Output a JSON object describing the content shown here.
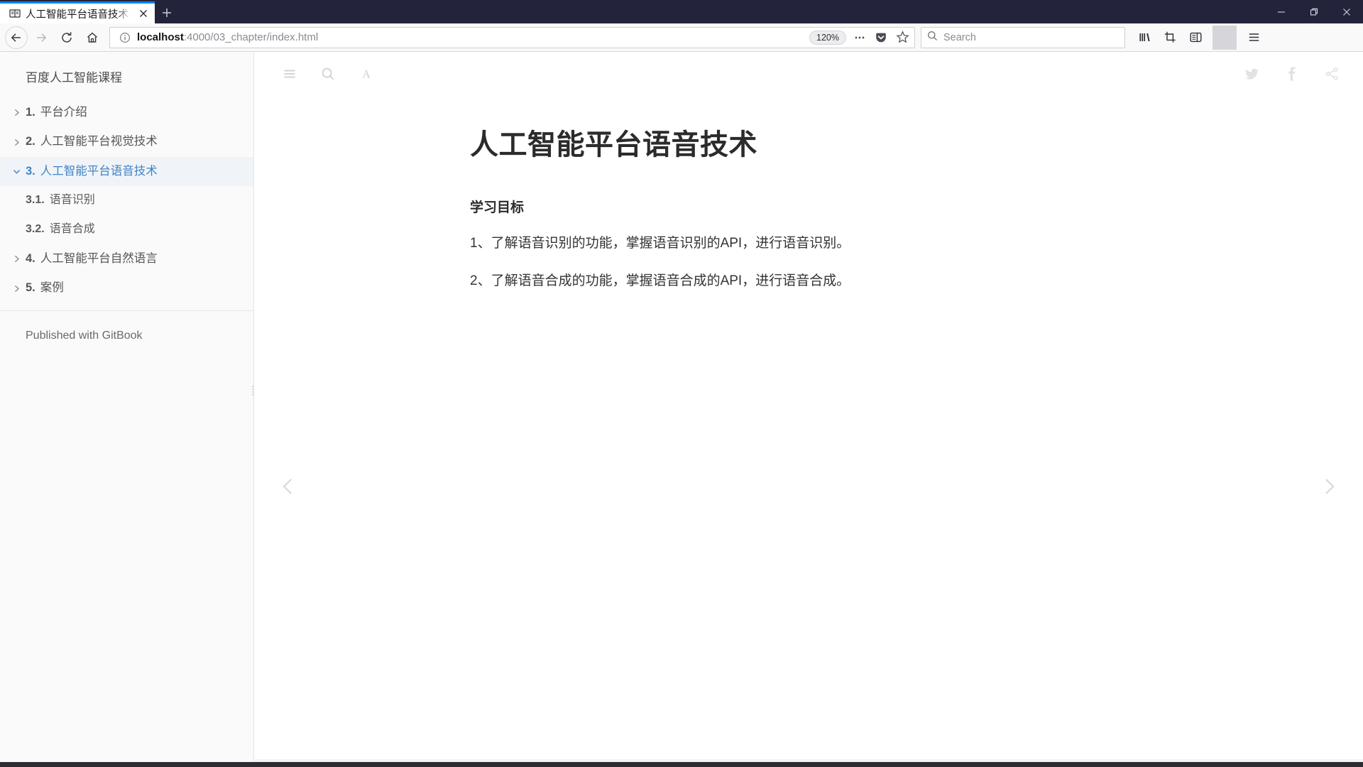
{
  "browser": {
    "tab": {
      "title": "人工智能平台语音技术 | 百度人",
      "favicon_icon": "book-favicon",
      "close_icon": "close-icon"
    },
    "new_tab_label": "+",
    "window_controls": {
      "minimize_icon": "minimize-icon",
      "maximize_icon": "maximize-icon",
      "close_icon": "window-close-icon"
    },
    "nav": {
      "back_icon": "back-arrow-icon",
      "forward_icon": "forward-arrow-icon",
      "reload_icon": "reload-icon",
      "home_icon": "home-icon"
    },
    "url_bar": {
      "info_icon": "info-circle-icon",
      "url_host": "localhost",
      "url_path": ":4000/03_chapter/index.html",
      "zoom_level": "120%",
      "page_actions_icon": "ellipsis-icon",
      "pocket_icon": "pocket-shield-icon",
      "bookmark_icon": "star-icon"
    },
    "search": {
      "icon": "search-icon",
      "placeholder": "Search",
      "value": ""
    },
    "toolbar_icons": {
      "library": "library-icon",
      "screenshot": "screenshot-crop-icon",
      "sidebar": "sidebar-toggle-icon",
      "menu": "hamburger-menu-icon"
    }
  },
  "sidebar": {
    "title": "百度人工智能课程",
    "items": [
      {
        "caret": "chevron-right-icon",
        "num": "1.",
        "label": "平台介绍",
        "active": false,
        "sub": false
      },
      {
        "caret": "chevron-right-icon",
        "num": "2.",
        "label": "人工智能平台视觉技术",
        "active": false,
        "sub": false
      },
      {
        "caret": "chevron-down-icon",
        "num": "3.",
        "label": "人工智能平台语音技术",
        "active": true,
        "sub": false
      },
      {
        "caret": "",
        "num": "3.1.",
        "label": "语音识别",
        "active": false,
        "sub": true
      },
      {
        "caret": "",
        "num": "3.2.",
        "label": "语音合成",
        "active": false,
        "sub": true
      },
      {
        "caret": "chevron-right-icon",
        "num": "4.",
        "label": "人工智能平台自然语言",
        "active": false,
        "sub": false
      },
      {
        "caret": "chevron-right-icon",
        "num": "5.",
        "label": "案例",
        "active": false,
        "sub": false
      }
    ],
    "footer": "Published with GitBook",
    "active_color": "#4183c4"
  },
  "book": {
    "toolbar": {
      "menu_icon": "hamburger-menu-icon",
      "search_icon": "search-icon",
      "font_icon": "font-size-icon",
      "twitter_icon": "twitter-icon",
      "facebook_icon": "facebook-icon",
      "share_icon": "share-icon"
    },
    "heading": "人工智能平台语音技术",
    "subheading": "学习目标",
    "paragraphs": [
      "1、了解语音识别的功能，掌握语音识别的API，进行语音识别。",
      "2、了解语音合成的功能，掌握语音合成的API，进行语音合成。"
    ],
    "prev_icon": "chevron-left-icon",
    "next_icon": "chevron-right-icon"
  }
}
